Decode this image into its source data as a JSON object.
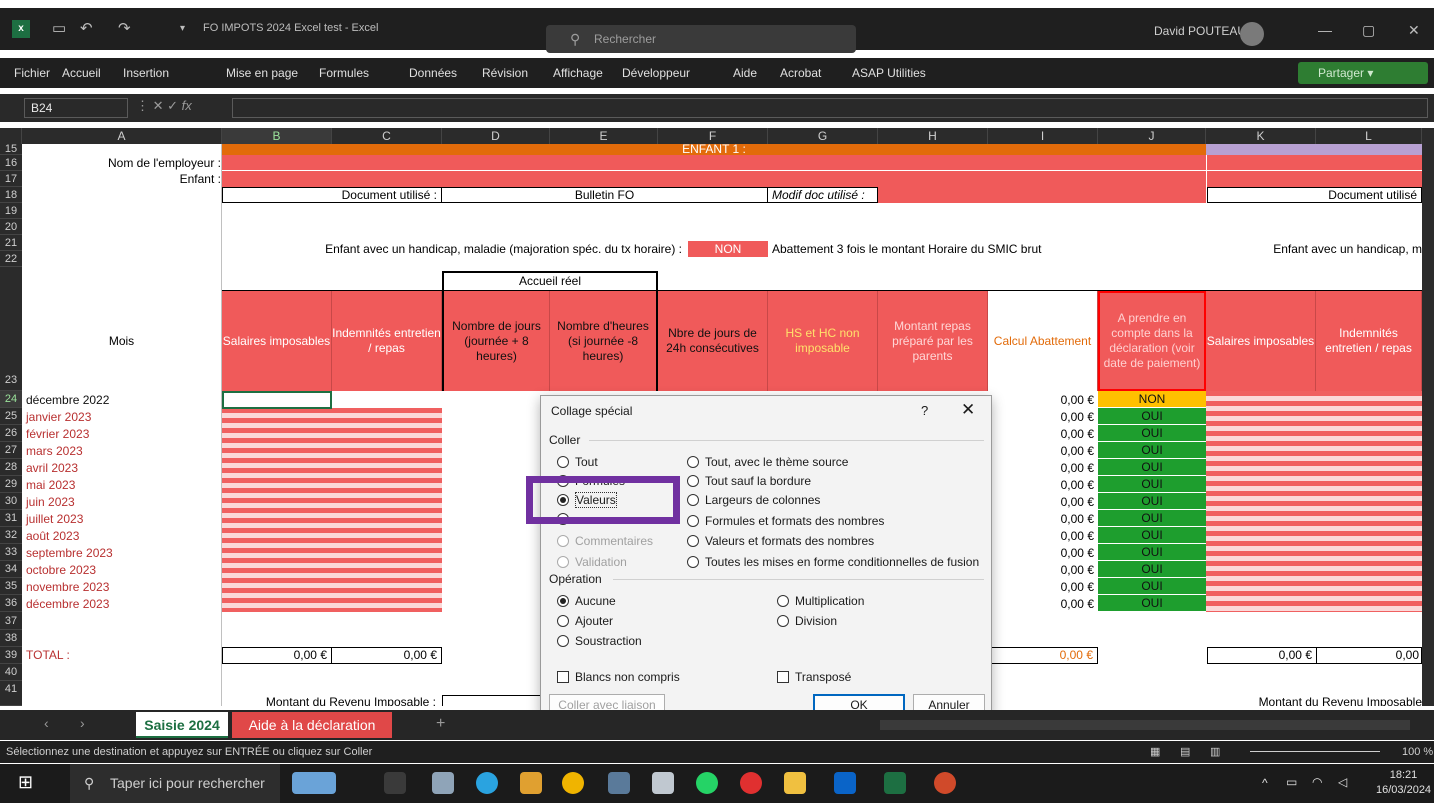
{
  "app": {
    "title": "FO IMPOTS 2024 Excel test - Excel",
    "search_placeholder": "Rechercher",
    "user": "David POUTEAU",
    "excel_letter": "x"
  },
  "menu": {
    "items": [
      "Fichier",
      "Accueil",
      "Insertion",
      "Mise en page",
      "Formules",
      "Données",
      "Révision",
      "Affichage",
      "Développeur",
      "Aide",
      "Acrobat",
      "ASAP Utilities"
    ],
    "share": "Partager"
  },
  "formula": {
    "namebox": "B24",
    "fx": "fx"
  },
  "columns": [
    "A",
    "B",
    "C",
    "D",
    "E",
    "F",
    "G",
    "H",
    "I",
    "J",
    "K",
    "L"
  ],
  "rows": [
    "15",
    "16",
    "17",
    "18",
    "19",
    "20",
    "21",
    "22",
    "23",
    "24",
    "25",
    "26",
    "27",
    "28",
    "29",
    "30",
    "31",
    "32",
    "33",
    "34",
    "35",
    "36",
    "37",
    "38",
    "39",
    "40",
    "41"
  ],
  "sheet": {
    "enfant1": "ENFANT 1 :",
    "employeur_label": "Nom de l'employeur :",
    "enfant_label": "Enfant :",
    "doc_label": "Document utilisé :",
    "doc_value": "Bulletin FO",
    "modif_label": "Modif doc utilisé :",
    "doc_label_right": "Document utilisé",
    "handicap_label": "Enfant avec un handicap, maladie (majoration spéc. du tx horaire) :",
    "handicap_value": "NON",
    "abattement_note": "Abattement 3 fois le montant Horaire du SMIC brut",
    "handicap_label_right": "Enfant avec un handicap, m",
    "accueil_reel": "Accueil réel",
    "mois": "Mois",
    "headers": [
      "Salaires imposables",
      "Indemnités entretien / repas",
      "Nombre de jours (journée + 8 heures)",
      "Nombre d'heures (si journée -8 heures)",
      "Nbre de jours de 24h consécutives",
      "HS et HC non imposable",
      "Montant repas préparé par les parents",
      "Calcul Abattement",
      "A prendre en compte dans la déclaration (voir date de paiement)",
      "Salaires imposables",
      "Indemnités entretien / repas"
    ],
    "months": [
      "décembre 2022",
      "janvier 2023",
      "février 2023",
      "mars 2023",
      "avril 2023",
      "mai 2023",
      "juin 2023",
      "juillet 2023",
      "août 2023",
      "septembre 2023",
      "octobre 2023",
      "novembre 2023",
      "décembre 2023"
    ],
    "calc_values": [
      "0,00 €",
      "0,00 €",
      "0,00 €",
      "0,00 €",
      "0,00 €",
      "0,00 €",
      "0,00 €",
      "0,00 €",
      "0,00 €",
      "0,00 €",
      "0,00 €",
      "0,00 €",
      "0,00 €"
    ],
    "declaration_values": [
      "NON",
      "OUI",
      "OUI",
      "OUI",
      "OUI",
      "OUI",
      "OUI",
      "OUI",
      "OUI",
      "OUI",
      "OUI",
      "OUI",
      "OUI"
    ],
    "total_label": "TOTAL :",
    "total_b": "0,00 €",
    "total_c": "0,00 €",
    "total_i": "0,00 €",
    "total_k": "0,00 €",
    "total_l": "0,00",
    "revenu_label": "Montant du Revenu Imposable :",
    "revenu_label_right": "Montant du Revenu Imposable"
  },
  "dialog": {
    "title": "Collage spécial",
    "help": "?",
    "close": "✕",
    "coller_group": "Coller",
    "left_options": [
      "Tout",
      "Formules",
      "Valeurs",
      "",
      "Commentaires",
      "Validation"
    ],
    "right_options": [
      "Tout, avec le thème source",
      "Tout sauf la bordure",
      "Largeurs de colonnes",
      "Formules et formats des nombres",
      "Valeurs et formats des nombres",
      "Toutes les mises en forme conditionnelles de fusion"
    ],
    "operation_group": "Opération",
    "op_left": [
      "Aucune",
      "Ajouter",
      "Soustraction"
    ],
    "op_right": [
      "Multiplication",
      "Division"
    ],
    "blancs": "Blancs non compris",
    "transpose": "Transposé",
    "coller_liaison": "Coller avec liaison",
    "ok": "OK",
    "annuler": "Annuler"
  },
  "tabs": {
    "sheet1": "Saisie 2024",
    "sheet2": "Aide à la déclaration",
    "add": "+"
  },
  "status": {
    "message": "Sélectionnez une destination et appuyez sur ENTRÉE ou cliquez sur Coller",
    "zoom": "100 %"
  },
  "taskbar": {
    "search": "Taper ici pour rechercher",
    "time": "18:21",
    "date": "16/03/2024"
  }
}
